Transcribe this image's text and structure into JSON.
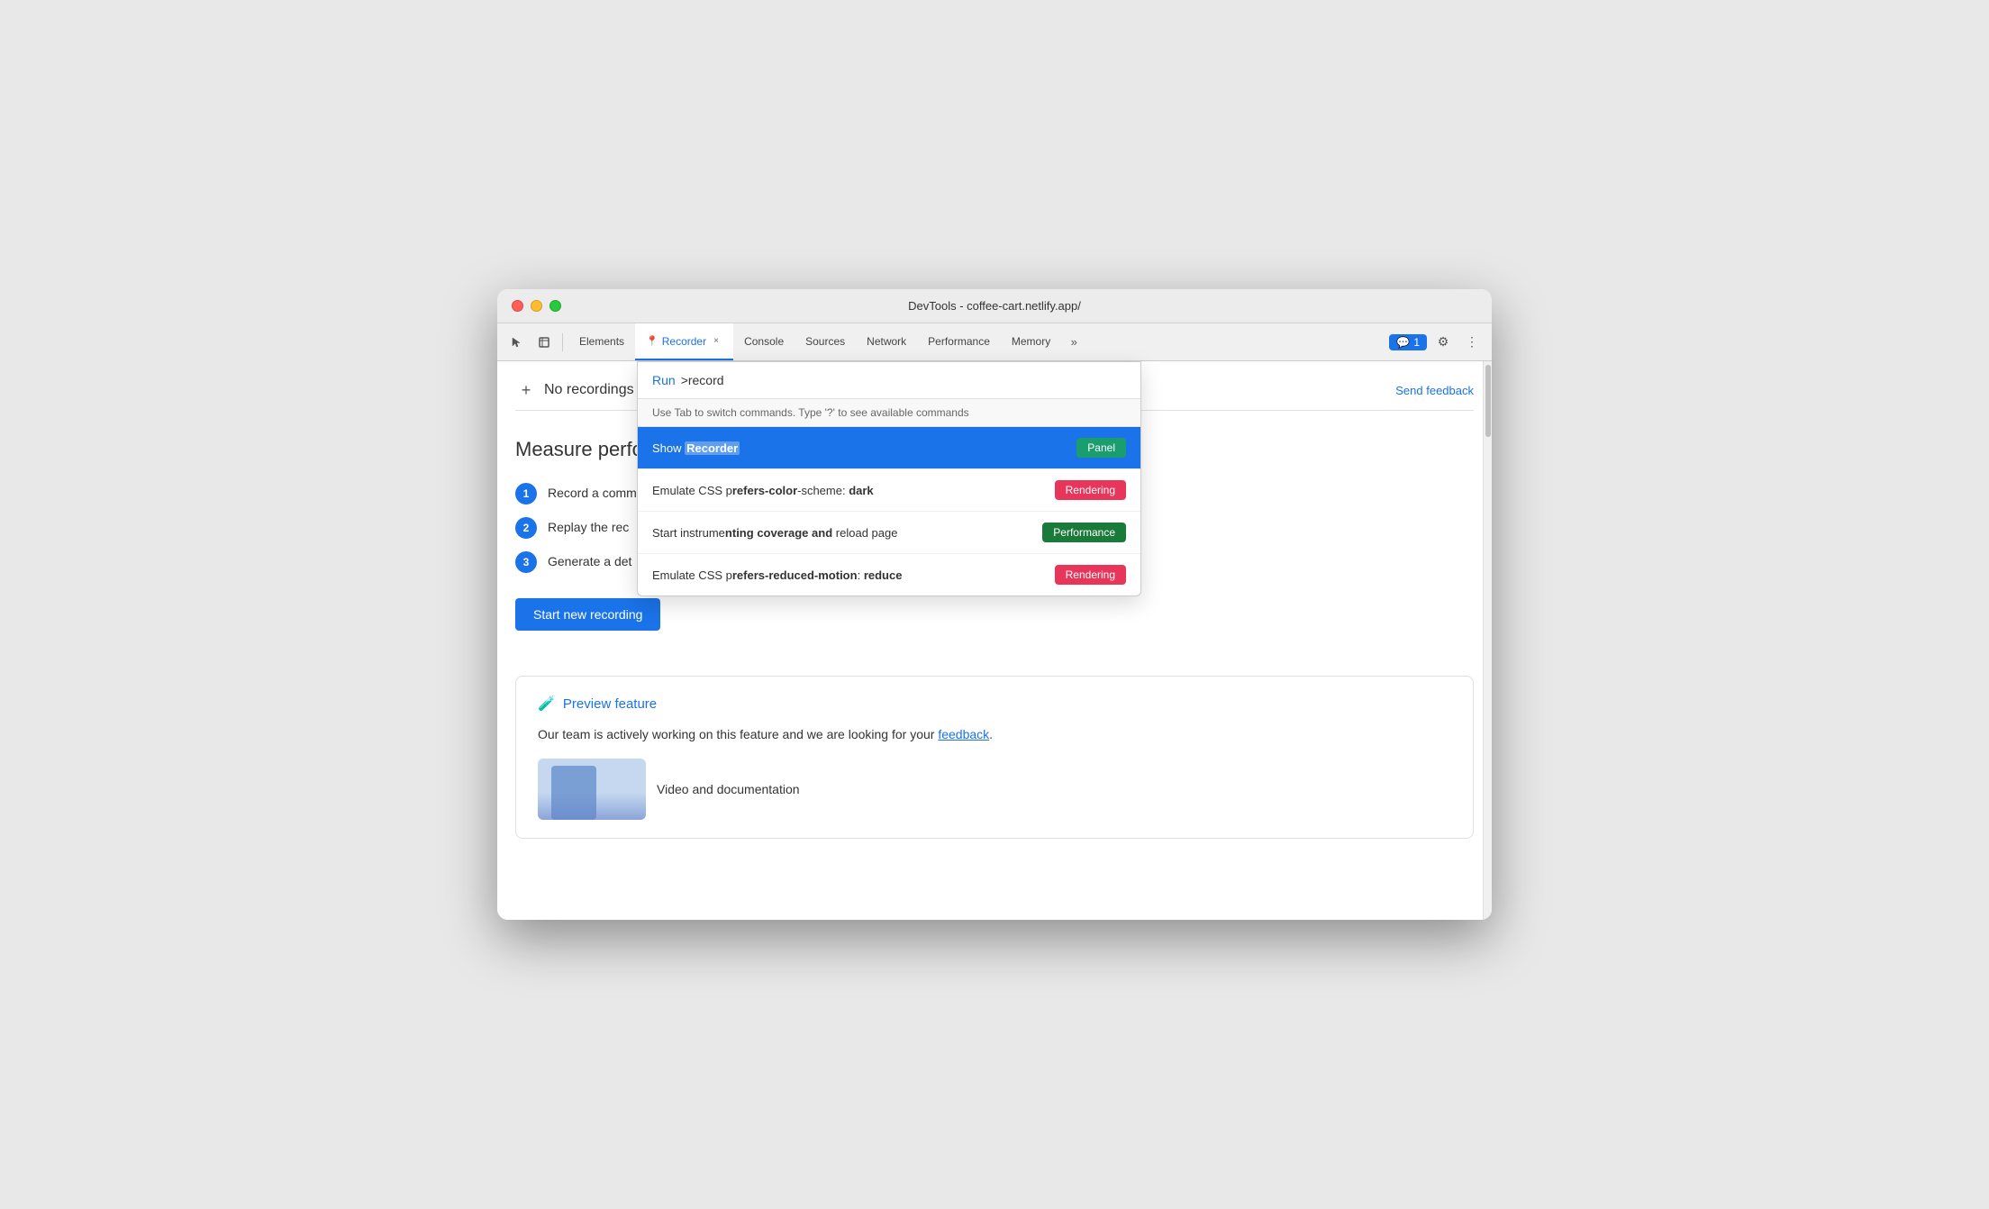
{
  "window": {
    "title": "DevTools - coffee-cart.netlify.app/"
  },
  "tabs": [
    {
      "id": "elements",
      "label": "Elements",
      "active": false
    },
    {
      "id": "recorder",
      "label": "Recorder",
      "active": true,
      "closable": true
    },
    {
      "id": "console",
      "label": "Console",
      "active": false
    },
    {
      "id": "sources",
      "label": "Sources",
      "active": false
    },
    {
      "id": "network",
      "label": "Network",
      "active": false
    },
    {
      "id": "performance",
      "label": "Performance",
      "active": false
    },
    {
      "id": "memory",
      "label": "Memory",
      "active": false
    }
  ],
  "toolbar": {
    "more_tabs_icon": "»",
    "chat_badge": "1",
    "settings_icon": "⚙",
    "more_icon": "⋮"
  },
  "recorder": {
    "add_button": "+",
    "no_recordings": "No recordings",
    "send_feedback": "Send feedback",
    "measure_title": "Measure perfo",
    "steps": [
      {
        "number": "1",
        "text": "Record a comm"
      },
      {
        "number": "2",
        "text": "Replay the rec"
      },
      {
        "number": "3",
        "text": "Generate a det"
      }
    ],
    "start_button": "Start new recording",
    "preview_icon": "🧪",
    "preview_label": "Preview feature",
    "preview_text": "Our team is actively working on this feature and we are looking for your ",
    "feedback_link": "feedback",
    "preview_text_end": ".",
    "video_docs": "Video and documentation"
  },
  "command_palette": {
    "run_label": "Run",
    "input_value": ">record",
    "hint": "Use Tab to switch commands. Type '?' to see available commands",
    "items": [
      {
        "id": "show-recorder",
        "text_before": "Show ",
        "text_highlight": "Recorder",
        "text_after": "",
        "badge_label": "Panel",
        "badge_type": "panel",
        "highlighted": true
      },
      {
        "id": "emulate-css-dark",
        "text_before": "Emulate CSS p",
        "text_highlight": "refers-color",
        "text_middle": "-scheme: ",
        "text_bold": "dark",
        "text_after": "",
        "badge_label": "Rendering",
        "badge_type": "rendering",
        "highlighted": false
      },
      {
        "id": "coverage-reload",
        "text_before": "Start instrume",
        "text_highlight": "nting ",
        "text_bold_start": "c",
        "text_bold_highlight": "overage",
        "text_bold_and": " and",
        "text_after": " reload page",
        "badge_label": "Performance",
        "badge_type": "performance",
        "highlighted": false
      },
      {
        "id": "emulate-css-motion",
        "text_before": "Emulate CSS p",
        "text_highlight": "refers-reduced-motion",
        "text_after": ": ",
        "text_bold": "reduce",
        "badge_label": "Rendering",
        "badge_type": "rendering",
        "highlighted": false
      }
    ]
  }
}
